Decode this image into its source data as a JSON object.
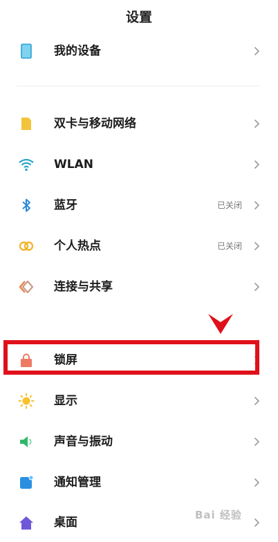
{
  "header": {
    "title": "设置"
  },
  "items": [
    {
      "label": "我的设备",
      "status": "",
      "icon": "phone-icon"
    },
    {
      "label": "双卡与移动网络",
      "status": "",
      "icon": "sim-card-icon"
    },
    {
      "label": "WLAN",
      "status": "",
      "icon": "wifi-icon"
    },
    {
      "label": "蓝牙",
      "status": "已关闭",
      "icon": "bluetooth-icon"
    },
    {
      "label": "个人热点",
      "status": "已关闭",
      "icon": "hotspot-icon"
    },
    {
      "label": "连接与共享",
      "status": "",
      "icon": "share-icon"
    },
    {
      "label": "锁屏",
      "status": "",
      "icon": "lock-icon"
    },
    {
      "label": "显示",
      "status": "",
      "icon": "brightness-icon"
    },
    {
      "label": "声音与振动",
      "status": "",
      "icon": "speaker-icon"
    },
    {
      "label": "通知管理",
      "status": "",
      "icon": "notification-icon"
    },
    {
      "label": "桌面",
      "status": "",
      "icon": "home-icon"
    }
  ],
  "colors": {
    "highlight": "#e0101a",
    "sim": "#f3c33c",
    "wifi": "#2aa5c9",
    "bluetooth": "#2b88d8",
    "hotspot": "#f2b632",
    "lock": "#ef7a63",
    "display": "#f6c12c",
    "sound": "#2fb86a",
    "notification": "#2b8fe0",
    "home": "#6e57d9"
  },
  "watermark": "Bai 经验"
}
